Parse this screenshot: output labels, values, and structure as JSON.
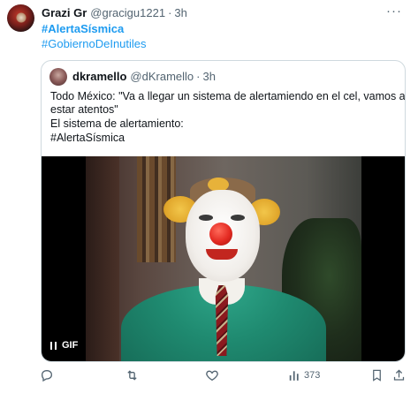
{
  "tweet": {
    "author": {
      "name": "Grazi Gr",
      "handle": "@gracigu1221",
      "time": "3h"
    },
    "more_label": "···",
    "hashtags": [
      "#AlertaSísmica",
      "#GobiernoDeInutiles"
    ],
    "quote": {
      "author": {
        "name": "dkramello",
        "handle": "@dKramello",
        "time": "3h"
      },
      "lines": [
        "Todo México: \"Va a llegar un sistema de alertamiendo en el cel, vamos a",
        "estar atentos\"",
        "El sistema de alertamiento:",
        " #AlertaSísmica"
      ],
      "media": {
        "type": "gif",
        "badge_label": "GIF"
      }
    },
    "actions": {
      "views_count": "373"
    },
    "colors": {
      "link": "#1d9bf0",
      "muted": "#536471",
      "border": "#cfd9de",
      "text": "#0f1419"
    }
  }
}
